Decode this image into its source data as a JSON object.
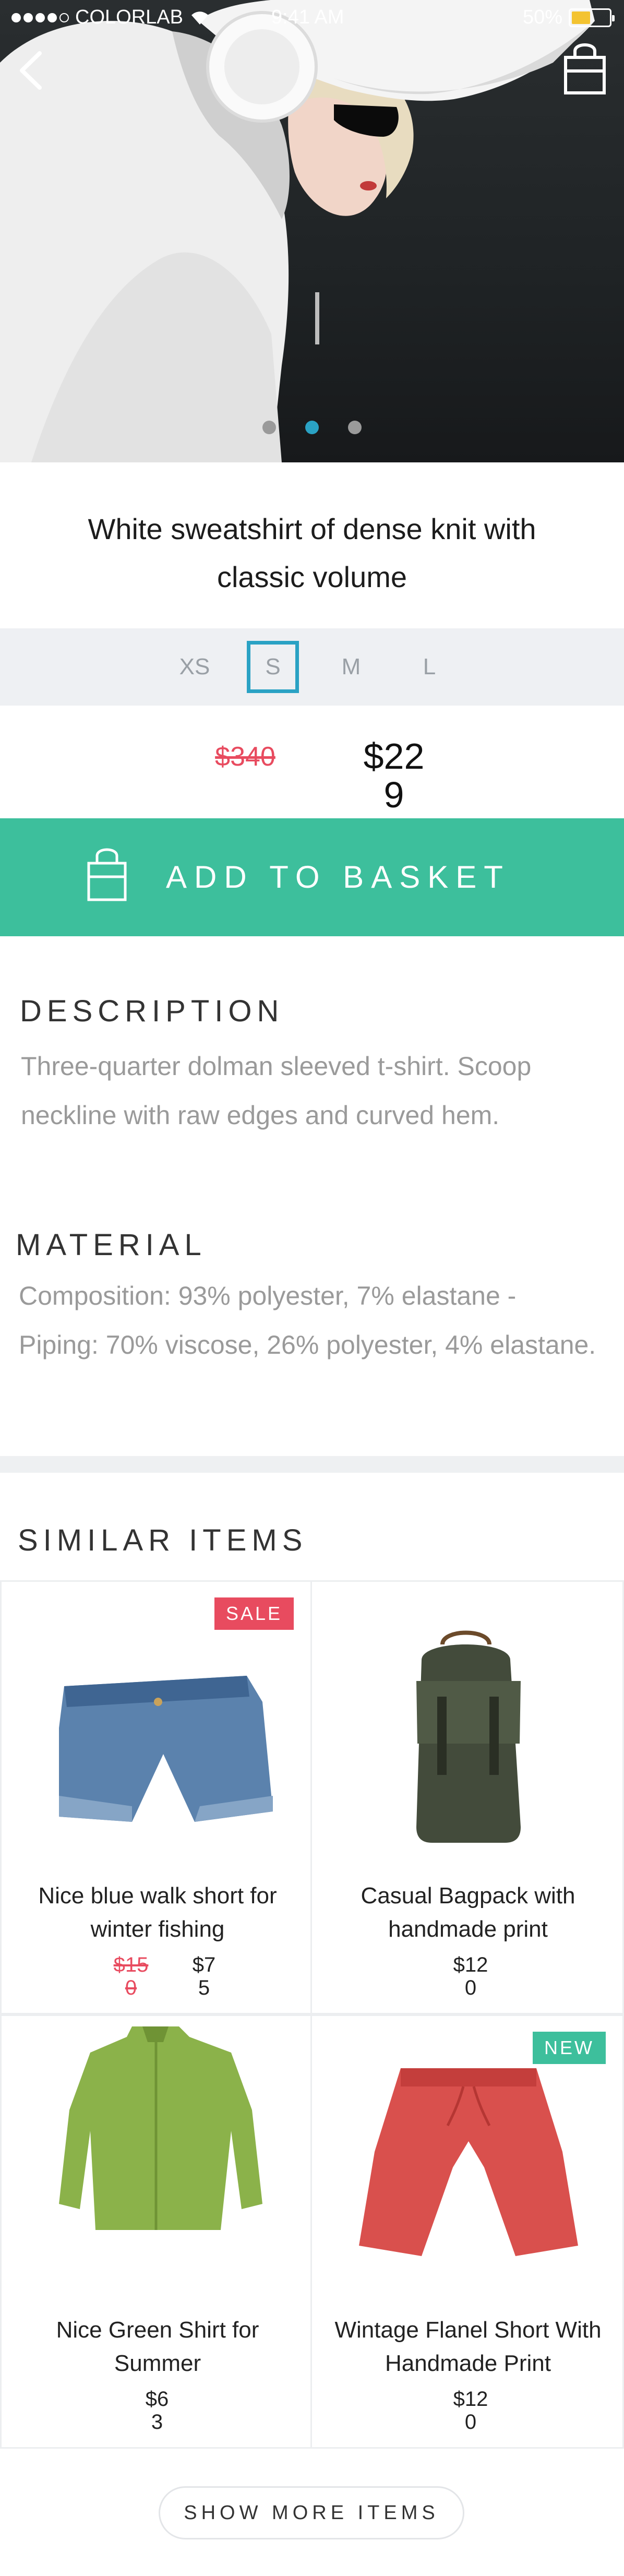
{
  "status_bar": {
    "carrier": "COLORLAB",
    "time": "9:41 AM",
    "battery": "50%",
    "battery_level": 0.5
  },
  "hero": {
    "page_count": 3,
    "active_page": 2
  },
  "product": {
    "title": "White sweatshirt of dense knit with classic volume",
    "sizes": [
      "XS",
      "S",
      "M",
      "L"
    ],
    "selected_size": "S",
    "old_price": "$340",
    "price": "$229"
  },
  "actions": {
    "add_to_basket": "ADD TO BASKET"
  },
  "description": {
    "heading": "DESCRIPTION",
    "text": "Three-quarter dolman sleeved t-shirt. Scoop neckline with raw edges and curved hem."
  },
  "material": {
    "heading": "MATERIAL",
    "text": "Composition: 93% polyester, 7% elastane - Piping: 70% viscose, 26% polyester, 4% elastane."
  },
  "similar": {
    "heading": "SIMILAR ITEMS",
    "items": [
      {
        "name": "Nice blue walk short for winter fishing",
        "badge": "SALE",
        "old_price": "$150",
        "price": "$75"
      },
      {
        "name": "Casual Bagpack with handmade print",
        "badge": "",
        "old_price": "",
        "price": "$120"
      },
      {
        "name": "Nice Green Shirt for Summer",
        "badge": "",
        "old_price": "",
        "price": "$63"
      },
      {
        "name": "Wintage Flanel Short With Handmade Print",
        "badge": "NEW",
        "old_price": "",
        "price": "$120"
      }
    ],
    "show_more": "SHOW MORE ITEMS"
  },
  "colors": {
    "accent": "#2aa2c4",
    "primary_button": "#3dbf9c",
    "sale": "#e84b5f"
  }
}
